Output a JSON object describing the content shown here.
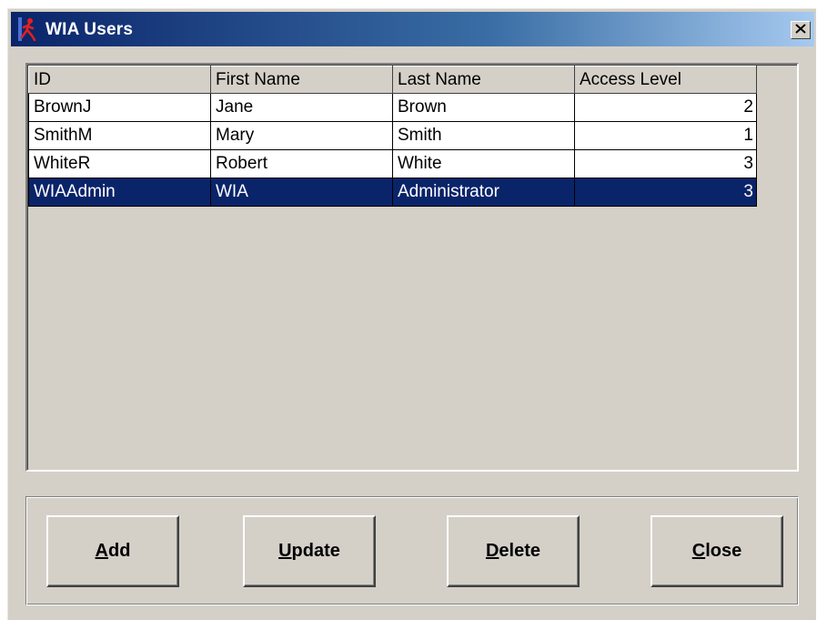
{
  "window": {
    "title": "WIA Users",
    "close_glyph": "✕",
    "titlebar_color": "#0a246a"
  },
  "table": {
    "columns": [
      "ID",
      "First Name",
      "Last Name",
      "Access Level"
    ],
    "rows": [
      {
        "id": "BrownJ",
        "first": "Jane",
        "last": "Brown",
        "level": "2"
      },
      {
        "id": "SmithM",
        "first": "Mary",
        "last": "Smith",
        "level": "1"
      },
      {
        "id": "WhiteR",
        "first": "Robert",
        "last": "White",
        "level": "3"
      },
      {
        "id": "WIAAdmin",
        "first": "WIA",
        "last": "Administrator",
        "level": "3"
      }
    ],
    "selected_row": 3,
    "selection_color": "#0a246a"
  },
  "buttons": {
    "add": {
      "accel": "A",
      "rest": "dd"
    },
    "update": {
      "accel": "U",
      "rest": "pdate"
    },
    "delete": {
      "accel": "D",
      "rest": "elete"
    },
    "close": {
      "accel": "C",
      "rest": "lose"
    }
  },
  "icons": {
    "app": "running-figure-icon",
    "close": "close-icon"
  }
}
